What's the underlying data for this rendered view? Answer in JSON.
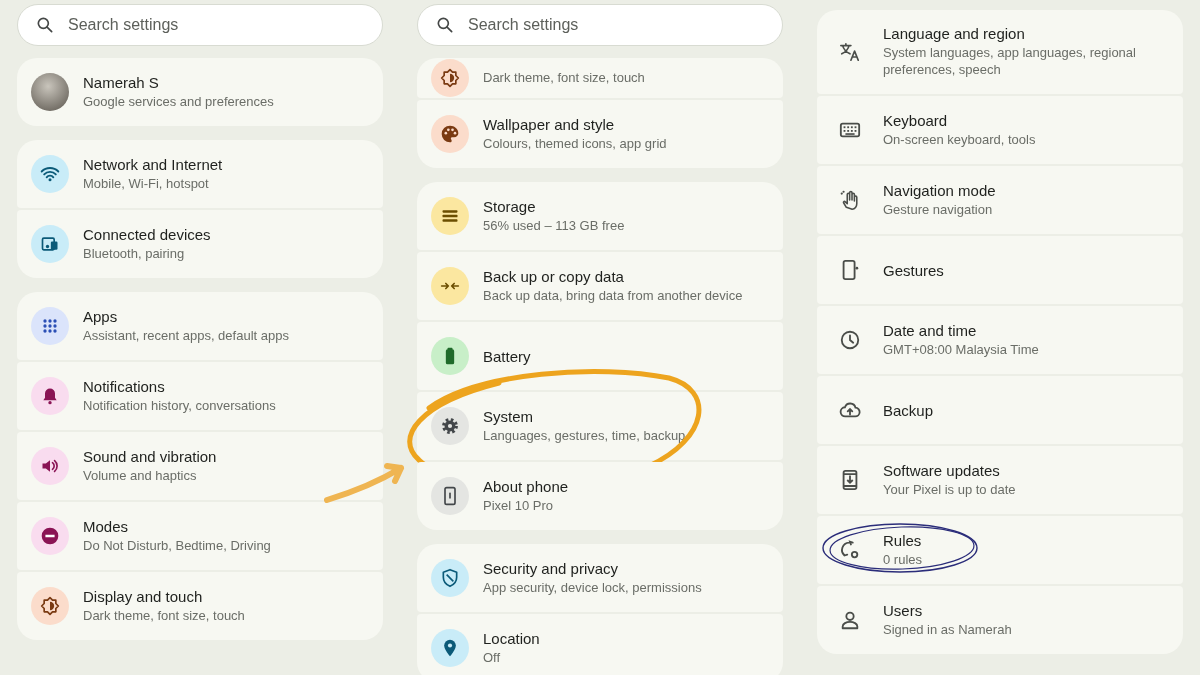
{
  "panels": [
    {
      "search": {
        "placeholder": "Search settings"
      },
      "groups": [
        {
          "items": [
            {
              "kind": "avatar",
              "title": "Namerah S",
              "subtitle": "Google services and preferences"
            }
          ]
        },
        {
          "items": [
            {
              "kind": "badge",
              "color": "#c9ecf8",
              "title": "Network and Internet",
              "subtitle": "Mobile, Wi-Fi, hotspot"
            },
            {
              "kind": "badge",
              "color": "#c9ecf8",
              "title": "Connected devices",
              "subtitle": "Bluetooth, pairing"
            }
          ]
        },
        {
          "items": [
            {
              "kind": "badge",
              "color": "#dbe4fb",
              "title": "Apps",
              "subtitle": "Assistant, recent apps, default apps"
            },
            {
              "kind": "badge",
              "color": "#f9dcef",
              "title": "Notifications",
              "subtitle": "Notification history, conversations"
            },
            {
              "kind": "badge",
              "color": "#f9dcef",
              "title": "Sound and vibration",
              "subtitle": "Volume and haptics"
            },
            {
              "kind": "badge",
              "color": "#f9dcef",
              "title": "Modes",
              "subtitle": "Do Not Disturb, Bedtime, Driving"
            },
            {
              "kind": "badge",
              "color": "#fbdccb",
              "title": "Display and touch",
              "subtitle": "Dark theme, font size, touch"
            }
          ]
        }
      ]
    },
    {
      "search": {
        "placeholder": "Search settings"
      },
      "groups": [
        {
          "items": [
            {
              "kind": "badge",
              "color": "#fbdccb",
              "subtitle": "Dark theme, font size, touch"
            },
            {
              "kind": "badge",
              "color": "#fbdccb",
              "title": "Wallpaper and style",
              "subtitle": "Colours, themed icons, app grid"
            }
          ]
        },
        {
          "items": [
            {
              "kind": "badge",
              "color": "#fbe7a0",
              "title": "Storage",
              "subtitle": "56% used – 113 GB free"
            },
            {
              "kind": "badge",
              "color": "#fbe7a0",
              "title": "Back up or copy data",
              "subtitle": "Back up data, bring data from another device"
            },
            {
              "kind": "badge",
              "color": "#c8efc8",
              "title": "Battery"
            },
            {
              "kind": "badge",
              "color": "#e4e5e2",
              "title": "System",
              "subtitle": "Languages, gestures, time, backup",
              "marks": [
                {
                  "kind": "ring",
                  "color": "#eda41e"
                },
                {
                  "kind": "arrow",
                  "color": "#efb552"
                }
              ]
            },
            {
              "kind": "badge",
              "color": "#e4e5e2",
              "title": "About phone",
              "subtitle": "Pixel 10 Pro"
            }
          ]
        },
        {
          "items": [
            {
              "kind": "badge",
              "color": "#c9ecf8",
              "title": "Security and privacy",
              "subtitle": "App security, device lock, permissions"
            },
            {
              "kind": "badge",
              "color": "#c9ecf8",
              "title": "Location",
              "subtitle": "Off"
            }
          ]
        }
      ]
    },
    {
      "groups": [
        {
          "items": [
            {
              "kind": "plain",
              "title": "Language and region",
              "subtitle": "System languages, app languages, regional preferences, speech"
            },
            {
              "kind": "plain",
              "title": "Keyboard",
              "subtitle": "On-screen keyboard, tools"
            },
            {
              "kind": "plain",
              "title": "Navigation mode",
              "subtitle": "Gesture navigation"
            },
            {
              "kind": "plain",
              "title": "Gestures"
            },
            {
              "kind": "plain",
              "title": "Date and time",
              "subtitle": "GMT+08:00 Malaysia Time"
            },
            {
              "kind": "plain",
              "title": "Backup"
            },
            {
              "kind": "plain",
              "title": "Software updates",
              "subtitle": "Your Pixel is up to date"
            },
            {
              "kind": "plain",
              "title": "Rules",
              "subtitle": "0 rules",
              "marks": [
                {
                  "kind": "ink-ring",
                  "color": "#2b2d7a"
                }
              ]
            },
            {
              "kind": "plain",
              "title": "Users",
              "subtitle": "Signed in as Namerah"
            }
          ]
        }
      ]
    }
  ]
}
